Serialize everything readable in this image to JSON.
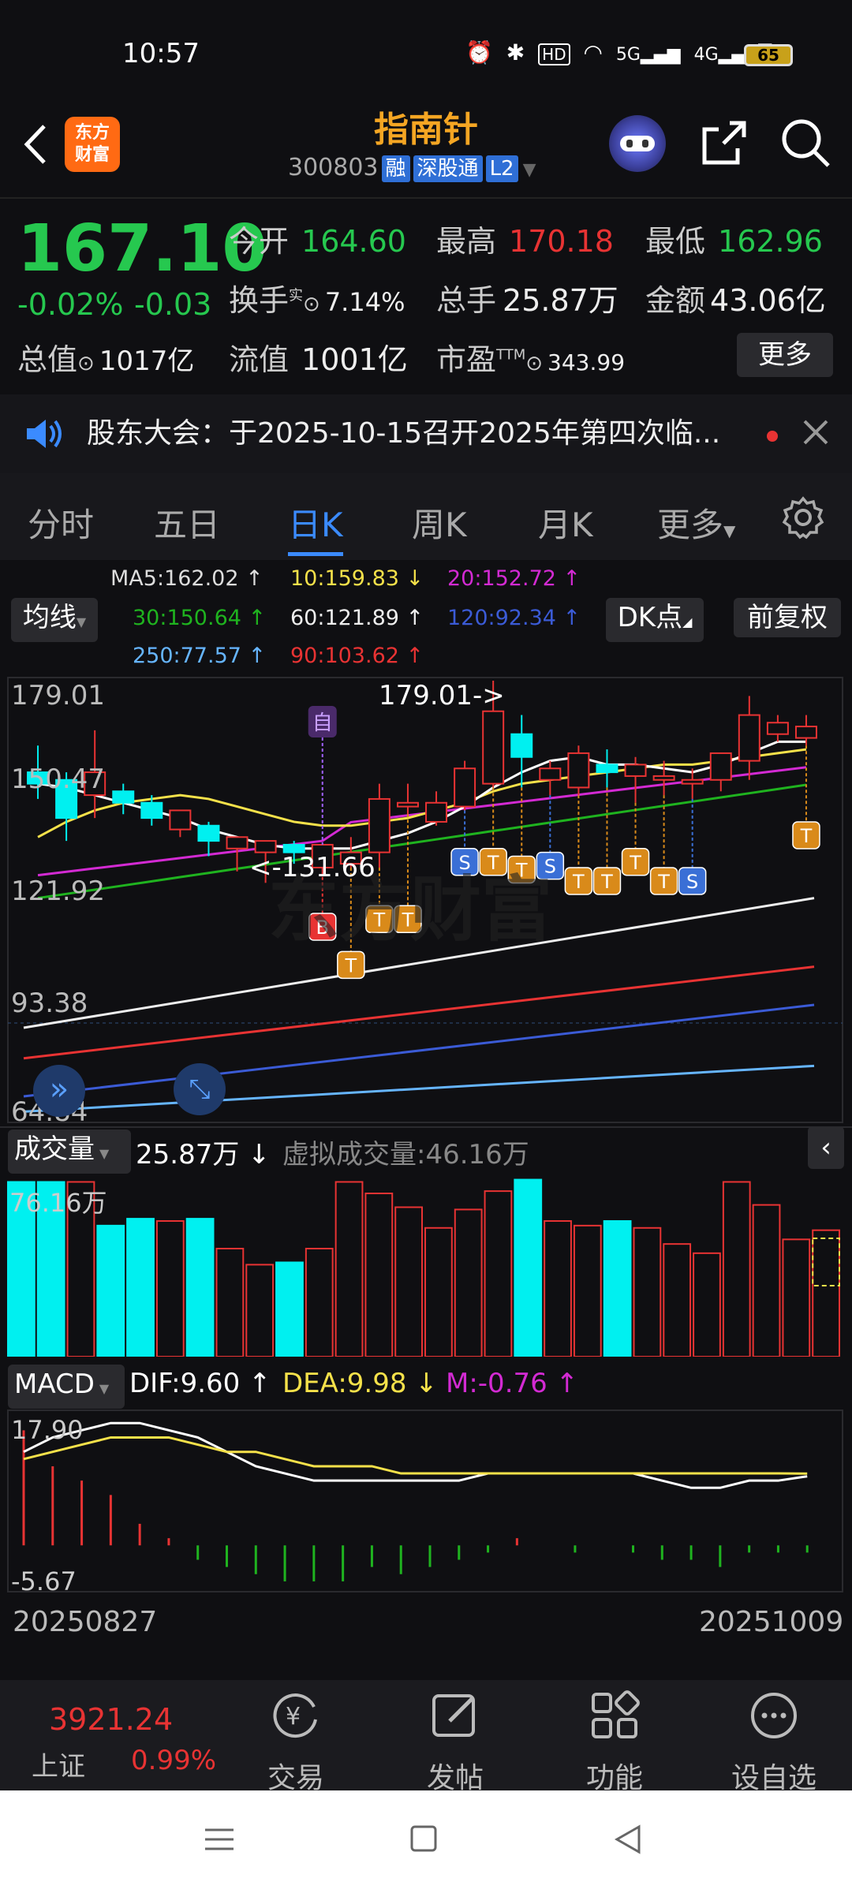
{
  "status_bar": {
    "time": "10:57",
    "icons": "⏰ ✱ HD 📶 5G 4G",
    "battery": "65"
  },
  "header": {
    "logo_text": "东方\n财富",
    "title": "指南针",
    "code": "300803",
    "tags": [
      "融",
      "深股通",
      "L2"
    ]
  },
  "quote": {
    "price": "167.10",
    "pct": "-0.02%",
    "chg": "-0.03",
    "open_label": "今开",
    "open": "164.60",
    "high_label": "最高",
    "high": "170.18",
    "low_label": "最低",
    "low": "162.96",
    "turnover_label": "换手",
    "turnover_sup": "实",
    "turnover": "7.14%",
    "volume_label": "总手",
    "volume": "25.87万",
    "amount_label": "金额",
    "amount": "43.06亿",
    "mcap_label": "总值",
    "mcap": "1017亿",
    "float_label": "流值",
    "float": "1001亿",
    "pe_label": "市盈",
    "pe_sup": "TTM",
    "pe": "343.99",
    "more": "更多"
  },
  "notice": {
    "text": "股东大会：于2025-10-15召开2025年第四次临..."
  },
  "tabs": [
    "分时",
    "五日",
    "日K",
    "周K",
    "月K",
    "更多"
  ],
  "active_tab": "日K",
  "kline": {
    "ma_button": "均线",
    "dk_button": "DK点",
    "fq_button": "前复权",
    "ma": [
      {
        "label": "MA5:162.02 ↑",
        "color": "#ffffff"
      },
      {
        "label": "10:159.83 ↓",
        "color": "#f5e14a"
      },
      {
        "label": "20:152.72 ↑",
        "color": "#d32ad3"
      },
      {
        "label": "30:150.64 ↑",
        "color": "#1fb31f"
      },
      {
        "label": "60:121.89 ↑",
        "color": "#eeeeee"
      },
      {
        "label": "120:92.34 ↑",
        "color": "#3b5bd6"
      },
      {
        "label": "250:77.57 ↑",
        "color": "#66b5ff"
      },
      {
        "label": "90:103.62 ↑",
        "color": "#e83333"
      }
    ],
    "y_labels": [
      "179.01",
      "150.47",
      "121.92",
      "93.38",
      "64.84"
    ],
    "max_annot": "179.01->",
    "min_annot": "<-131.66",
    "watermark": "东方财富"
  },
  "volume": {
    "label": "成交量",
    "value": "25.87万 ↓",
    "virtual": "虚拟成交量:46.16万",
    "max": "76.16万"
  },
  "macd": {
    "label": "MACD",
    "dif": "DIF:9.60 ↑",
    "dea": "DEA:9.98 ↓",
    "m": "M:-0.76 ↑",
    "max": "17.90",
    "min": "-5.67"
  },
  "dates": {
    "start": "20250827",
    "end": "20251009"
  },
  "bottom": {
    "index_value": "3921.24",
    "index_name": "上证",
    "index_pct": "0.99%",
    "items": [
      "交易",
      "发帖",
      "功能",
      "设自选"
    ]
  },
  "chart_data": {
    "type": "candlestick",
    "x": [
      "20250827",
      "20251009"
    ],
    "candles": [
      {
        "o": 155,
        "h": 162,
        "l": 148,
        "c": 152
      },
      {
        "o": 153,
        "h": 155,
        "l": 137,
        "c": 143
      },
      {
        "o": 149,
        "h": 166,
        "l": 143,
        "c": 155
      },
      {
        "o": 150,
        "h": 152,
        "l": 144,
        "c": 147
      },
      {
        "o": 147,
        "h": 149,
        "l": 141,
        "c": 143
      },
      {
        "o": 140,
        "h": 145,
        "l": 138,
        "c": 145
      },
      {
        "o": 141,
        "h": 142,
        "l": 133,
        "c": 137
      },
      {
        "o": 135,
        "h": 138,
        "l": 129,
        "c": 138
      },
      {
        "o": 134,
        "h": 137,
        "l": 126,
        "c": 137
      },
      {
        "o": 136,
        "h": 137,
        "l": 131,
        "c": 134
      },
      {
        "o": 130,
        "h": 136,
        "l": 129,
        "c": 136
      },
      {
        "o": 131,
        "h": 138,
        "l": 130,
        "c": 134
      },
      {
        "o": 134,
        "h": 152,
        "l": 130,
        "c": 148
      },
      {
        "o": 146,
        "h": 152,
        "l": 144,
        "c": 147
      },
      {
        "o": 142,
        "h": 150,
        "l": 141,
        "c": 147
      },
      {
        "o": 146,
        "h": 158,
        "l": 145,
        "c": 156
      },
      {
        "o": 152,
        "h": 179,
        "l": 151,
        "c": 171
      },
      {
        "o": 165,
        "h": 170,
        "l": 151,
        "c": 159
      },
      {
        "o": 153,
        "h": 158,
        "l": 149,
        "c": 156
      },
      {
        "o": 151,
        "h": 162,
        "l": 149,
        "c": 160
      },
      {
        "o": 157,
        "h": 161,
        "l": 151,
        "c": 155
      },
      {
        "o": 154,
        "h": 159,
        "l": 147,
        "c": 157
      },
      {
        "o": 153,
        "h": 158,
        "l": 149,
        "c": 154
      },
      {
        "o": 152,
        "h": 156,
        "l": 148,
        "c": 153
      },
      {
        "o": 153,
        "h": 160,
        "l": 150,
        "c": 160
      },
      {
        "o": 158,
        "h": 175,
        "l": 153,
        "c": 170
      },
      {
        "o": 165,
        "h": 170,
        "l": 163,
        "c": 168
      },
      {
        "o": 164,
        "h": 170,
        "l": 162,
        "c": 167
      }
    ],
    "volume": [
      76,
      76,
      76,
      57,
      60,
      59,
      60,
      47,
      40,
      41,
      47,
      76,
      71,
      65,
      56,
      64,
      72,
      77,
      59,
      57,
      59,
      56,
      49,
      45,
      76,
      66,
      51,
      55
    ],
    "macd_bars": [
      16,
      11,
      9,
      7,
      3,
      1,
      -2,
      -3,
      -4,
      -5,
      -5,
      -5,
      -3,
      -4,
      -3,
      -2,
      -1,
      1,
      0,
      -1,
      0,
      -1,
      -2,
      -2,
      -3,
      -1,
      -1,
      -1
    ]
  }
}
